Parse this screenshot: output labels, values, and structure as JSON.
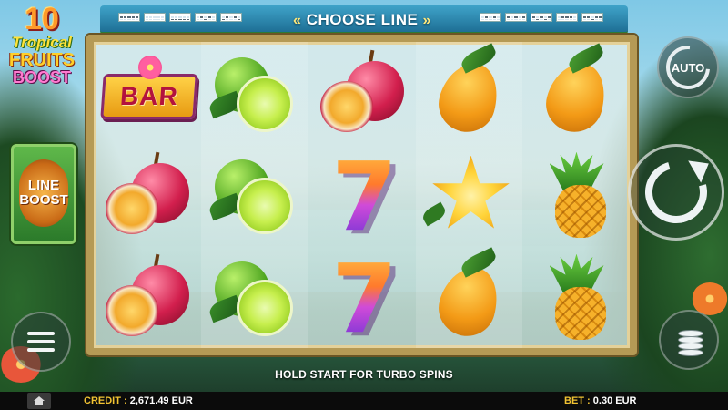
{
  "game": {
    "logo": {
      "line1": "10",
      "line2": "Tropical",
      "line3": "FRUITS",
      "line4": "BOOST"
    },
    "choose_line": "CHOOSE LINE",
    "choose_line_left_chevron": "«",
    "choose_line_right_chevron": "»",
    "line_boost": {
      "line1": "LINE",
      "line2": "BOOST"
    },
    "auto_label": "AUTO",
    "hold_message": "HOLD START FOR TURBO SPINS",
    "reels": [
      [
        "bar",
        "passion-fruit",
        "passion-fruit"
      ],
      [
        "lime",
        "lime",
        "lime"
      ],
      [
        "passion-fruit",
        "seven",
        "seven"
      ],
      [
        "mango",
        "star-fruit",
        "mango"
      ],
      [
        "mango",
        "pineapple",
        "pineapple"
      ]
    ],
    "bar_symbol_text": "BAR",
    "seven_symbol_text": "7",
    "colors": {
      "frame": "#b59a55",
      "top_bar": "#2b89b2",
      "credit_label": "#f1c232"
    }
  },
  "bottom_bar": {
    "credit_label": "CREDIT :",
    "credit_value": "2,671.49 EUR",
    "bet_label": "BET :",
    "bet_value": "0.30 EUR",
    "home_icon": "home-icon"
  }
}
